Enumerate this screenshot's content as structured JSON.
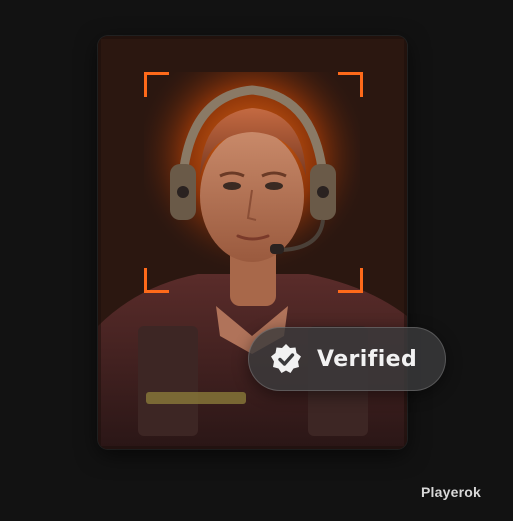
{
  "badge": {
    "label": "Verified",
    "icon": "verified-check-icon"
  },
  "watermark": {
    "text": "Playerok"
  },
  "colors": {
    "background": "#121212",
    "accent": "#ff6a1a",
    "pill": "#3a3a3c",
    "text": "#f2f2f2"
  },
  "icons": [
    "verified-check-icon"
  ]
}
